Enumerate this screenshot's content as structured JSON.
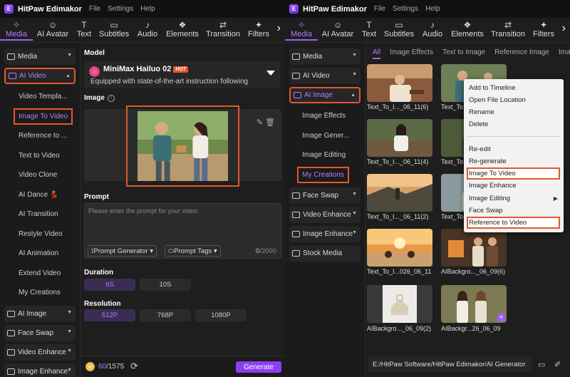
{
  "app": {
    "title": "HitPaw Edimakor",
    "logo": "E",
    "menu": [
      "File",
      "Settings",
      "Help"
    ]
  },
  "toolbar": {
    "tools": [
      {
        "label": "Media",
        "icon": "✧"
      },
      {
        "label": "AI Avatar",
        "icon": "☺"
      },
      {
        "label": "Text",
        "icon": "T"
      },
      {
        "label": "Subtitles",
        "icon": "▭"
      },
      {
        "label": "Audio",
        "icon": "♪"
      },
      {
        "label": "Elements",
        "icon": "❖"
      },
      {
        "label": "Transition",
        "icon": "⇄"
      },
      {
        "label": "Filters",
        "icon": "✦"
      }
    ],
    "more": "›"
  },
  "left_panel": {
    "sidebar": {
      "media": "Media",
      "ai_video": "AI Video",
      "sub_items": [
        "Video Templa...",
        "Image To Video",
        "Reference to ...",
        "Text to Video",
        "Video Clone",
        "AI Dance 💃",
        "AI Transition",
        "Restyle Video",
        "AI Animation",
        "Extend Video",
        "My Creations"
      ],
      "bottom_items": [
        "AI Image",
        "Face Swap",
        "Video Enhance",
        "Image Enhance"
      ]
    },
    "model_label": "Model",
    "model_name": "MiniMax Hailuo 02",
    "model_badge": "HOT",
    "model_desc": "Equipped with state-of-the-art instruction following",
    "image_label": "Image",
    "info_icon": "i",
    "image_tools": "✎  🗑",
    "prompt_label": "Prompt",
    "prompt_placeholder": "Please enter the prompt for your video.",
    "prompt_generator": "Prompt Generator ▾",
    "prompt_tags": "Prompt Tags ▾",
    "prompt_count": "0",
    "prompt_max": "/2000",
    "duration_label": "Duration",
    "durations": [
      "6S",
      "10S"
    ],
    "resolution_label": "Resolution",
    "resolutions": [
      "512P",
      "768P",
      "1080P"
    ],
    "credits": "60",
    "credits_total": "/1575",
    "refresh_icon": "⟳",
    "generate": "Generate"
  },
  "right_panel": {
    "sidebar": {
      "items": [
        "Media",
        "AI Video",
        "AI Image",
        "Face Swap",
        "Video Enhance",
        "Image Enhance",
        "Stock Media"
      ],
      "sub_items": [
        "Image Effects",
        "Image Gener...",
        "Image Editing",
        "My Creations"
      ]
    },
    "tabs": [
      "All",
      "Image Effects",
      "Text to Image",
      "Reference Image",
      "Ima"
    ],
    "thumbs": [
      {
        "label": "Text_To_I..._06_11(6)"
      },
      {
        "label": "Text_To"
      },
      {
        "label": "Text_To_I..._06_11(4)"
      },
      {
        "label": "Text_To"
      },
      {
        "label": "Text_To_I..._06_11(2)"
      },
      {
        "label": "Text_To"
      },
      {
        "label": "Text_To_I...026_06_11"
      },
      {
        "label": "AIBackgro..._06_09(6)"
      },
      {
        "label": "AIBackgro..._06_09(2)"
      },
      {
        "label": "AIBackgr...26_06_09"
      }
    ],
    "path": "E:/HitPaw Software/HitPaw Edimakor/AI Generator",
    "folder_icon": "▭",
    "clean_icon": "✐"
  },
  "context_menu": {
    "items": [
      "Add to Timeline",
      "Open File Location",
      "Rename",
      "Delete",
      "Re-edit",
      "Re-generate",
      "Image To Video",
      "Image Enhance",
      "Image Editing",
      "Face Swap",
      "Reference to Video"
    ],
    "submenu_arrow": "▶"
  },
  "colors": {
    "accent": "#a35cff",
    "highlight_box": "#e4572e",
    "background": "#1e1e1e"
  }
}
